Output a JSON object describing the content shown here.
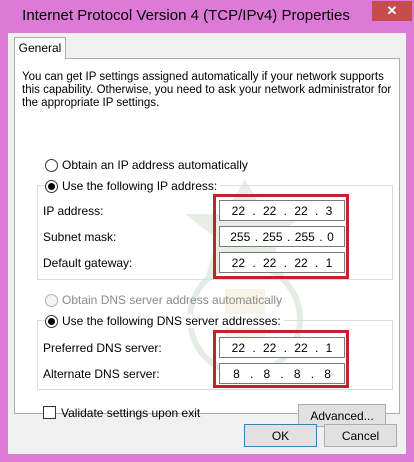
{
  "window": {
    "title": "Internet Protocol Version 4 (TCP/IPv4) Properties",
    "close_glyph": "✕"
  },
  "tabs": [
    {
      "label": "General"
    }
  ],
  "general": {
    "intro": "You can get IP settings assigned automatically if your network supports this capability. Otherwise, you need to ask your network administrator for the appropriate IP settings.",
    "ip_auto_label": "Obtain an IP address automatically",
    "ip_manual_label": "Use the following IP address:",
    "ip_mode": "manual",
    "ip_fields": [
      {
        "label": "IP address:",
        "octets": [
          "22",
          "22",
          "22",
          "3"
        ]
      },
      {
        "label": "Subnet mask:",
        "octets": [
          "255",
          "255",
          "255",
          "0"
        ]
      },
      {
        "label": "Default gateway:",
        "octets": [
          "22",
          "22",
          "22",
          "1"
        ]
      }
    ],
    "dns_auto_label": "Obtain DNS server address automatically",
    "dns_manual_label": "Use the following DNS server addresses:",
    "dns_mode": "manual",
    "dns_fields": [
      {
        "label": "Preferred DNS server:",
        "octets": [
          "22",
          "22",
          "22",
          "1"
        ]
      },
      {
        "label": "Alternate DNS server:",
        "octets": [
          "8",
          "8",
          "8",
          "8"
        ]
      }
    ],
    "validate_label": "Validate settings upon exit",
    "validate_checked": false,
    "advanced_label": "Advanced..."
  },
  "footer": {
    "ok_label": "OK",
    "cancel_label": "Cancel"
  },
  "colors": {
    "highlight_border": "#c91f2a",
    "title_bar": "#dd7ad7"
  }
}
